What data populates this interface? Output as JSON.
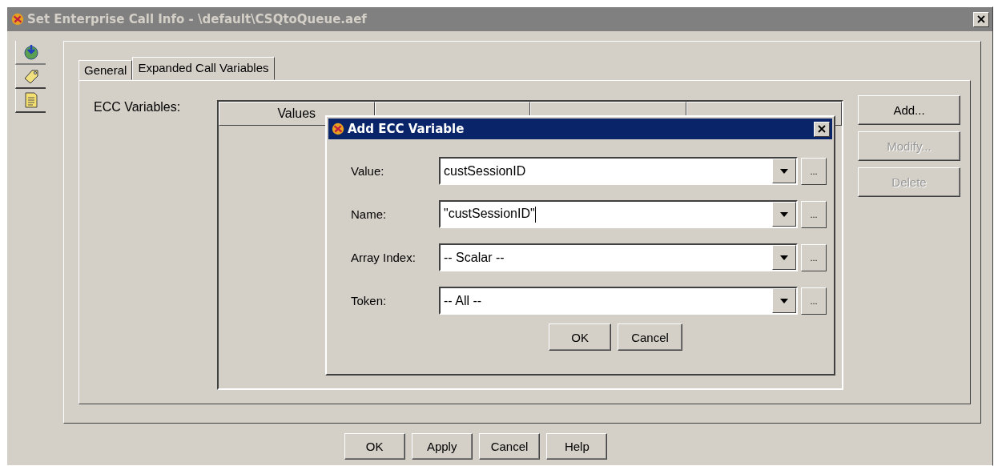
{
  "window": {
    "title": "Set Enterprise Call Info - \\default\\CSQtoQueue.aef",
    "active": false
  },
  "side_tabs": [
    {
      "kind": "globe",
      "selected": true
    },
    {
      "kind": "tag",
      "selected": false
    },
    {
      "kind": "document",
      "selected": false
    }
  ],
  "tabs": [
    {
      "label": "General",
      "selected": false
    },
    {
      "label": "Expanded Call Variables",
      "selected": true
    }
  ],
  "ecc_label": "ECC Variables:",
  "table": {
    "columns": [
      "Values"
    ]
  },
  "side_buttons": [
    {
      "label": "Add...",
      "disabled": false
    },
    {
      "label": "Modify...",
      "disabled": true
    },
    {
      "label": "Delete",
      "disabled": true
    }
  ],
  "dialog": {
    "title": "Add ECC Variable",
    "active": true,
    "fields": [
      {
        "label": "Value:",
        "value": "custSessionID",
        "focused": false
      },
      {
        "label": "Name:",
        "value": "\"custSessionID\"",
        "focused": true
      },
      {
        "label": "Array Index:",
        "value": "-- Scalar --",
        "focused": false
      },
      {
        "label": "Token:",
        "value": "-- All --",
        "focused": false
      }
    ],
    "browse_label": "...",
    "buttons": [
      "OK",
      "Cancel"
    ]
  },
  "buttons": [
    "OK",
    "Apply",
    "Cancel",
    "Help"
  ]
}
